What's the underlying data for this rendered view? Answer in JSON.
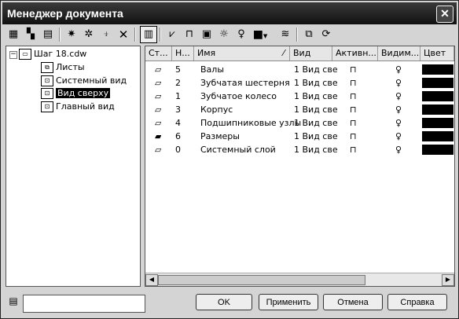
{
  "window": {
    "title": "Менеджер документа",
    "close_glyph": "✕"
  },
  "toolbar": {
    "icons": [
      "new-sheet-icon",
      "new-view-icon",
      "new-layer-icon",
      "delete-hidden-icon",
      "filter-icon",
      "filter-settings-icon",
      "delete-icon",
      "view-mode-icon",
      "check-layers-icon",
      "lock-open-icon",
      "lock-icon",
      "bulb-on-icon",
      "bulb-icon",
      "color-swatch-icon",
      "layer-style-icon",
      "copy-properties-icon",
      "refresh-icon"
    ]
  },
  "tree": {
    "root": "Шаг 18.cdw",
    "children": [
      "Листы",
      "Системный вид",
      "Вид сверху",
      "Главный вид"
    ],
    "selected": "Вид сверху"
  },
  "list": {
    "headers": [
      "Ст...",
      "Н...",
      "Имя",
      "Вид",
      "Активн...",
      "Видим...",
      "Цвет"
    ],
    "rows": [
      {
        "num": "5",
        "name": "Валы",
        "view": "1 Вид све"
      },
      {
        "num": "2",
        "name": "Зубчатая шестерня",
        "view": "1 Вид све"
      },
      {
        "num": "1",
        "name": "Зубчатое колесо",
        "view": "1 Вид све"
      },
      {
        "num": "3",
        "name": "Корпус",
        "view": "1 Вид све"
      },
      {
        "num": "4",
        "name": "Подшипниковые узлы",
        "view": "1 Вид све"
      },
      {
        "num": "6",
        "name": "Размеры",
        "view": "1 Вид све"
      },
      {
        "num": "0",
        "name": "Системный слой",
        "view": "1 Вид све"
      }
    ],
    "color_swatch": "#000000"
  },
  "footer": {
    "input_value": "",
    "ok": "OK",
    "apply": "Применить",
    "cancel": "Отмена",
    "help": "Справка"
  }
}
